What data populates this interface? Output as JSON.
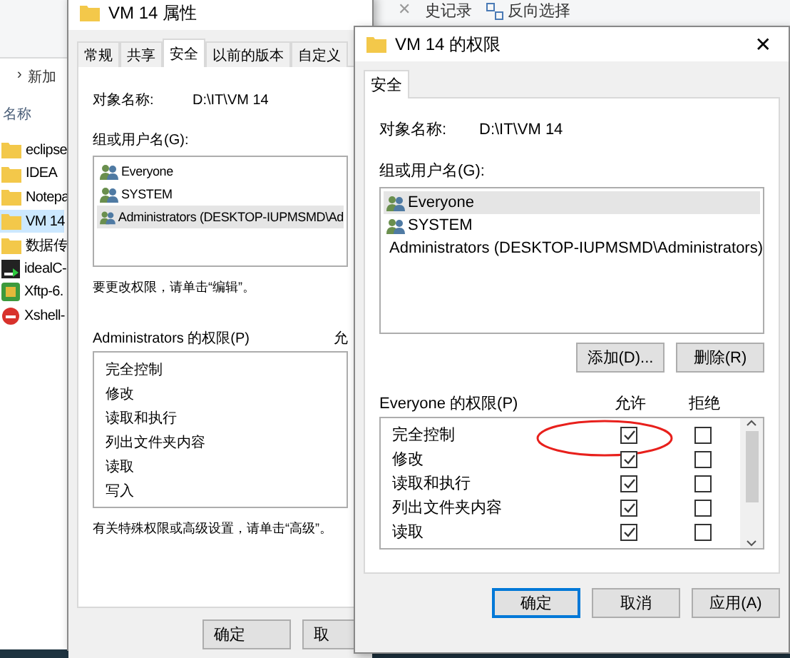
{
  "explorer": {
    "search_clear": "✕",
    "ribbon": [
      {
        "label": "史记录",
        "kind": "text"
      },
      {
        "label": "反向选择",
        "kind": "grid"
      }
    ],
    "breadcrumb_sep": "›",
    "breadcrumb": "新加",
    "column": "名称",
    "files": [
      {
        "name": "eclipse",
        "kind": "folder",
        "selected": false
      },
      {
        "name": "IDEA",
        "kind": "folder",
        "selected": false
      },
      {
        "name": "Notepa",
        "kind": "folder",
        "selected": false
      },
      {
        "name": "VM 14",
        "kind": "folder",
        "selected": true
      },
      {
        "name": "数据传",
        "kind": "folder",
        "selected": false
      },
      {
        "name": "idealC-",
        "kind": "app",
        "selected": false
      },
      {
        "name": "Xftp-6.",
        "kind": "ftp",
        "selected": false
      },
      {
        "name": "Xshell-",
        "kind": "shell",
        "selected": false
      }
    ]
  },
  "properties_window": {
    "title": "VM 14 属性",
    "tabs": [
      {
        "label": "常规",
        "selected": false
      },
      {
        "label": "共享",
        "selected": false
      },
      {
        "label": "安全",
        "selected": true
      },
      {
        "label": "以前的版本",
        "selected": false
      },
      {
        "label": "自定义",
        "selected": false
      }
    ],
    "object_label": "对象名称:",
    "object_value": "D:\\IT\\VM 14",
    "groups_label": "组或用户名(G):",
    "groups": [
      {
        "name": "Everyone",
        "selected": false
      },
      {
        "name": "SYSTEM",
        "selected": false
      },
      {
        "name": "Administrators (DESKTOP-IUPMSMD\\Ad",
        "selected": true
      }
    ],
    "edit_hint": "要更改权限，请单击“编辑”。",
    "perm_label": "Administrators 的权限(P)",
    "allow_header": "允",
    "permissions": [
      "完全控制",
      "修改",
      "读取和执行",
      "列出文件夹内容",
      "读取",
      "写入"
    ],
    "advanced_hint": "有关特殊权限或高级设置，请单击“高级”。",
    "buttons": [
      "确定",
      "取"
    ]
  },
  "permissions_window": {
    "title": "VM 14 的权限",
    "close": "✕",
    "tabs": [
      {
        "label": "安全",
        "selected": true
      }
    ],
    "object_label": "对象名称:",
    "object_value": "D:\\IT\\VM 14",
    "groups_label": "组或用户名(G):",
    "groups": [
      {
        "name": "Everyone",
        "selected": true
      },
      {
        "name": "SYSTEM",
        "selected": false
      },
      {
        "name": "Administrators (DESKTOP-IUPMSMD\\Administrators)",
        "selected": false
      }
    ],
    "group_buttons": [
      "添加(D)...",
      "删除(R)"
    ],
    "perm_label": "Everyone 的权限(P)",
    "allow_header": "允许",
    "deny_header": "拒绝",
    "permissions": [
      {
        "name": "完全控制",
        "allow": true,
        "deny": false,
        "highlighted": true
      },
      {
        "name": "修改",
        "allow": true,
        "deny": false,
        "highlighted": false
      },
      {
        "name": "读取和执行",
        "allow": true,
        "deny": false,
        "highlighted": false
      },
      {
        "name": "列出文件夹内容",
        "allow": true,
        "deny": false,
        "highlighted": false
      },
      {
        "name": "读取",
        "allow": true,
        "deny": false,
        "highlighted": false
      }
    ],
    "buttons": [
      {
        "label": "确定",
        "default": true
      },
      {
        "label": "取消",
        "default": false
      },
      {
        "label": "应用(A)",
        "default": false
      }
    ]
  }
}
